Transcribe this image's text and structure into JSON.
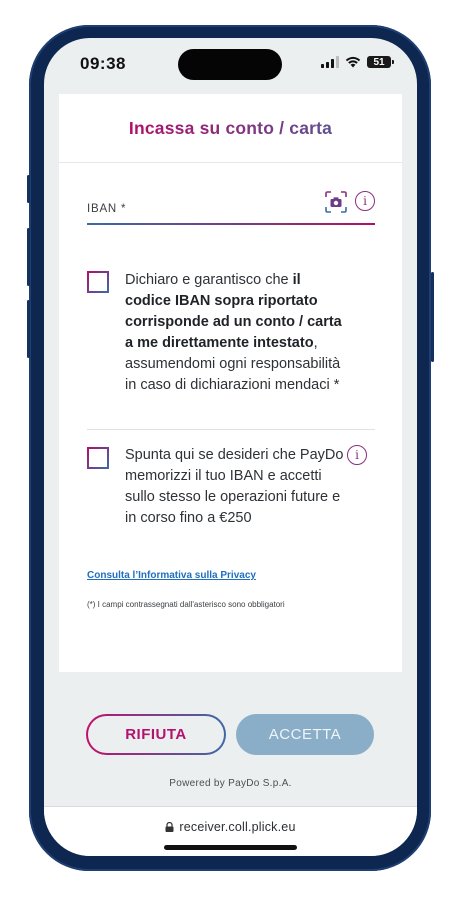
{
  "status_bar": {
    "time": "09:38",
    "battery": "51"
  },
  "page": {
    "title": "Incassa su conto / carta"
  },
  "iban": {
    "label": "IBAN *",
    "value": ""
  },
  "declaration": {
    "part1": "Dichiaro e garantisco che ",
    "bold": "il codice IBAN sopra riportato corrisponde ad un conto / carta a me direttamente intestato",
    "part2": ", assumendomi ogni responsabilità in caso di dichiarazioni mendaci *"
  },
  "store_consent": {
    "text": "Spunta qui se desideri che PayDo memorizzi il tuo IBAN e accetti sullo stesso le operazioni future e in corso fino a €250"
  },
  "privacy_link": "Consulta l’Informativa sulla Privacy",
  "required_note": "(*) I campi contrassegnati dall'asterisco sono obbligatori",
  "buttons": {
    "reject": "RIFIUTA",
    "accept": "ACCETTA"
  },
  "footer": {
    "powered_by": "Powered by PayDo S.p.A."
  },
  "browser": {
    "url": "receiver.coll.plick.eu"
  },
  "colors": {
    "brand_magenta": "#b0106a",
    "brand_blue": "#3c6aa6",
    "accept_disabled": "#8aaec8"
  },
  "icons": [
    "signal-icon",
    "wifi-icon",
    "battery-icon",
    "camera-scan-icon",
    "info-icon",
    "lock-icon"
  ]
}
